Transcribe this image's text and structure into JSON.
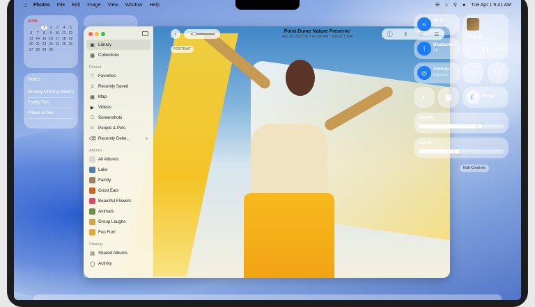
{
  "menubar": {
    "app": "Photos",
    "items": [
      "File",
      "Edit",
      "Image",
      "View",
      "Window",
      "Help"
    ],
    "clock": "Tue Apr 1  9:41 AM"
  },
  "calendar": {
    "month": "APRIL",
    "days": [
      "",
      "",
      "1",
      "2",
      "3",
      "4",
      "5",
      "6",
      "7",
      "8",
      "9",
      "10",
      "11",
      "12",
      "13",
      "14",
      "15",
      "16",
      "17",
      "18",
      "19",
      "20",
      "21",
      "22",
      "23",
      "24",
      "25",
      "26",
      "27",
      "28",
      "29",
      "30"
    ],
    "today": "1"
  },
  "notes": {
    "title": "Notes",
    "items": [
      "Monday Morning Meeting",
      "Family Fun",
      "Places to hike"
    ]
  },
  "photo_viewer": {
    "title": "Point Dume Nature Preserve",
    "subtitle": "July 16, 2023 at 7:41:03 PM  ·  235 of 1,040",
    "badge": "PORTRAIT"
  },
  "sidebar": {
    "top": [
      {
        "label": "Library",
        "icon": "photo-stack-icon"
      },
      {
        "label": "Collections",
        "icon": "collections-icon"
      }
    ],
    "pinned_header": "Pinned",
    "pinned": [
      {
        "label": "Favorites",
        "icon": "heart-icon"
      },
      {
        "label": "Recently Saved",
        "icon": "download-icon"
      },
      {
        "label": "Map",
        "icon": "map-icon"
      },
      {
        "label": "Videos",
        "icon": "video-icon"
      },
      {
        "label": "Screenshots",
        "icon": "screenshot-icon"
      },
      {
        "label": "People & Pets",
        "icon": "person-icon"
      },
      {
        "label": "Recently Delet...",
        "icon": "trash-icon"
      }
    ],
    "albums_header": "Albums",
    "albums": [
      {
        "label": "All Albums",
        "color": "#d9d9d9"
      },
      {
        "label": "Lake",
        "color": "#4f7fb0"
      },
      {
        "label": "Family",
        "color": "#a07f66"
      },
      {
        "label": "Good Eats",
        "color": "#c9632b"
      },
      {
        "label": "Beautiful Flowers",
        "color": "#d84c6f"
      },
      {
        "label": "Animals",
        "color": "#6f8c4f"
      },
      {
        "label": "Group Laughs",
        "color": "#d0a250"
      },
      {
        "label": "Fun Fun!",
        "color": "#e0a93a"
      }
    ],
    "sharing_header": "Sharing",
    "sharing": [
      {
        "label": "Shared Albums",
        "icon": "shared-album-icon"
      },
      {
        "label": "Activity",
        "icon": "activity-icon"
      }
    ]
  },
  "control_center": {
    "wifi": {
      "label": "Wi-Fi",
      "sub": "Home Wi-Fi"
    },
    "bluetooth": {
      "label": "Bluetooth",
      "sub": "On"
    },
    "airdrop": {
      "label": "AirDrop",
      "sub": "Everyone"
    },
    "music": {
      "title": "Control",
      "sub": "Syd – Broken Heart..."
    },
    "focus": {
      "label": "Focus"
    },
    "display": {
      "label": "Display",
      "level": 0.72
    },
    "sound": {
      "label": "Sound",
      "level": 0.45
    },
    "edit": "Edit Controls"
  },
  "colors": {
    "accent": "#1b7cf5"
  }
}
